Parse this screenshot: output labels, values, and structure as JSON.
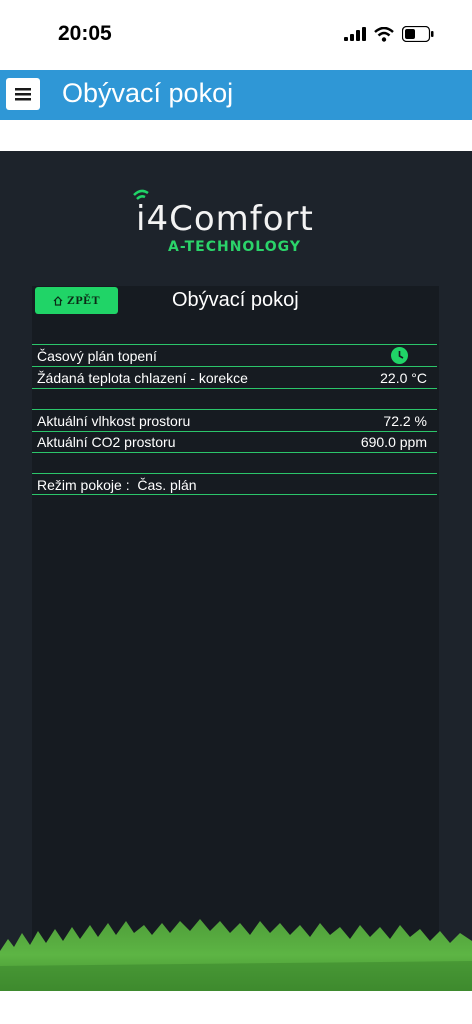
{
  "status_bar": {
    "time": "20:05"
  },
  "app_bar": {
    "title": "Obývací pokoj"
  },
  "logo": {
    "main": "i4Comfort",
    "sub": "A-TECHNOLOGY"
  },
  "panel": {
    "back_label": "ZPĚT",
    "title": "Obývací pokoj",
    "rows": [
      {
        "label": "Časový plán topení",
        "value": "",
        "icon": "clock-icon"
      },
      {
        "label": "Žádaná teplota chlazení - korekce",
        "value": "22.0 °C"
      },
      {
        "label": "Aktuální vlhkost prostoru",
        "value": "72.2 %"
      },
      {
        "label": "Aktuální CO2 prostoru",
        "value": "690.0 ppm"
      },
      {
        "label": "Režim pokoje :  Čas. plán",
        "value": ""
      }
    ]
  },
  "colors": {
    "accent": "#20d467",
    "header": "#2f97d6",
    "background": "#1d232b"
  }
}
